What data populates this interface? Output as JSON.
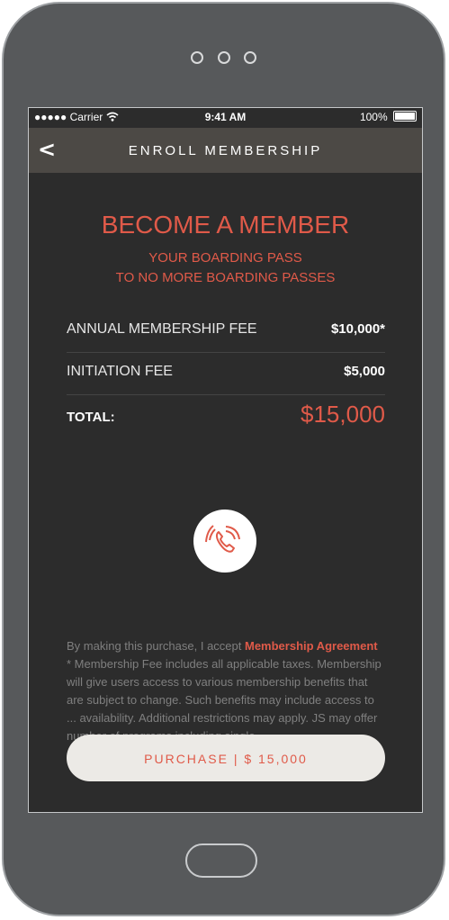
{
  "status_bar": {
    "carrier": "●●●●● Carrier",
    "time": "9:41 AM",
    "battery": "100%"
  },
  "nav": {
    "back_glyph": "<",
    "title": "ENROLL MEMBERSHIP"
  },
  "hero": {
    "headline": "BECOME A MEMBER",
    "subline_1": "YOUR BOARDING PASS",
    "subline_2": "TO NO MORE BOARDING PASSES"
  },
  "fees": [
    {
      "label": "ANNUAL MEMBERSHIP FEE",
      "value": "$10,000*"
    },
    {
      "label": "INITIATION FEE",
      "value": "$5,000"
    }
  ],
  "total": {
    "label": "TOTAL:",
    "value": "$15,000"
  },
  "call_button": {
    "icon": "phone-call-icon"
  },
  "legal": {
    "prefix": "By making this purchase, I accept ",
    "link": "Membership Agreement",
    "body": "* Membership Fee includes all applicable taxes. Membership will give users access to various membership benefits that are subject to change. Such benefits may include access to ... availability. Additional restrictions may apply. JS may offer number of programs including single-"
  },
  "purchase_button": {
    "label": "PURCHASE   |   $ 15,000"
  },
  "colors": {
    "accent": "#e05a49",
    "background": "#2c2c2c",
    "navbar": "#4c4945",
    "button_bg": "#eceae6"
  }
}
